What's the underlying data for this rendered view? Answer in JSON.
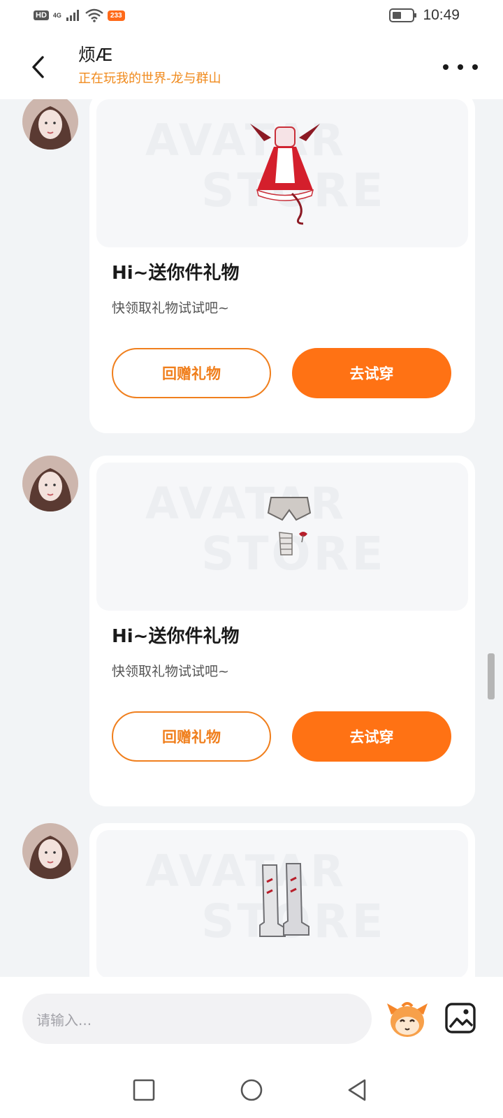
{
  "status_bar": {
    "hd": "HD",
    "network": "4G",
    "app_badge": "233",
    "time": "10:49"
  },
  "header": {
    "title": "烦Æ",
    "subtitle": "正在玩我的世界-龙与群山"
  },
  "watermark": {
    "line1": "AVATAR",
    "line2": "STORE"
  },
  "messages": [
    {
      "title": "Hi~送你件礼物",
      "desc": "快领取礼物试试吧~",
      "btn_return": "回赠礼物",
      "btn_try": "去试穿",
      "item_icon": "maid-dress-icon"
    },
    {
      "title": "Hi~送你件礼物",
      "desc": "快领取礼物试试吧~",
      "btn_return": "回赠礼物",
      "btn_try": "去试穿",
      "item_icon": "shorts-garter-icon"
    },
    {
      "item_icon": "boots-icon"
    }
  ],
  "input": {
    "placeholder": "请输入..."
  },
  "colors": {
    "accent": "#ff7214",
    "subtitle": "#f08a1c",
    "background": "#f2f4f6"
  }
}
